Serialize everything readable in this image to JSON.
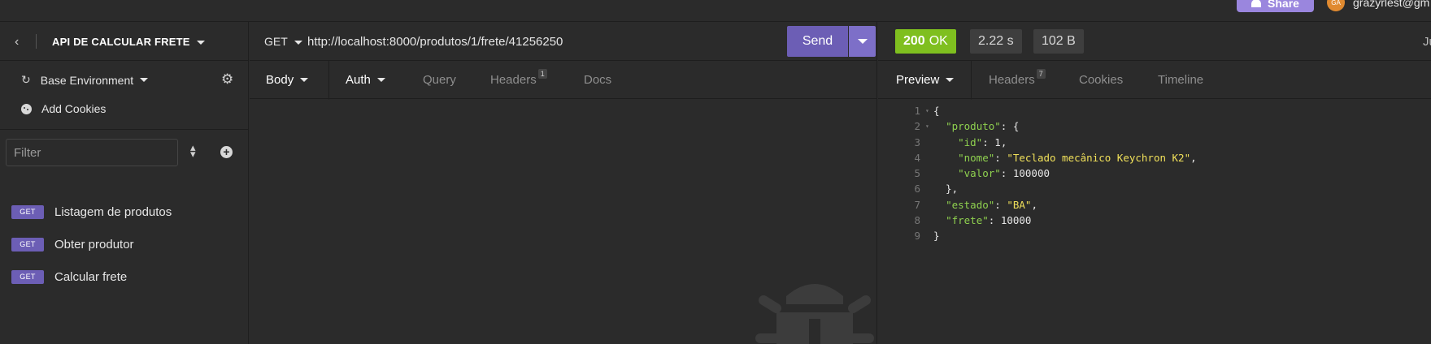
{
  "topbar": {
    "share_label": "Share",
    "avatar_initials": "GA",
    "user_email": "grazyrlest@gm"
  },
  "sidebar": {
    "project_title": "API DE CALCULAR FRETE",
    "environment_label": "Base Environment",
    "cookies_label": "Add Cookies",
    "filter_placeholder": "Filter",
    "requests": [
      {
        "method": "GET",
        "name": "Listagem de produtos"
      },
      {
        "method": "GET",
        "name": "Obter produtor"
      },
      {
        "method": "GET",
        "name": "Calcular frete"
      }
    ]
  },
  "request": {
    "method": "GET",
    "url": "http://localhost:8000/produtos/1/frete/41256250",
    "send_label": "Send",
    "tabs": {
      "body": "Body",
      "auth": "Auth",
      "query": "Query",
      "headers": "Headers",
      "headers_count": "1",
      "docs": "Docs"
    }
  },
  "response": {
    "status_code": "200",
    "status_text": "OK",
    "time": "2.22 s",
    "size": "102 B",
    "clipped_label": "Ju",
    "tabs": {
      "preview": "Preview",
      "headers": "Headers",
      "headers_count": "7",
      "cookies": "Cookies",
      "timeline": "Timeline"
    },
    "body_lines": [
      {
        "n": "1",
        "fold": true
      },
      {
        "n": "2",
        "fold": true
      },
      {
        "n": "3"
      },
      {
        "n": "4"
      },
      {
        "n": "5"
      },
      {
        "n": "6"
      },
      {
        "n": "7"
      },
      {
        "n": "8"
      },
      {
        "n": "9"
      }
    ],
    "json": {
      "produto_key": "\"produto\"",
      "id_key": "\"id\"",
      "id_val": "1",
      "nome_key": "\"nome\"",
      "nome_val": "\"Teclado mecânico Keychron K2\"",
      "valor_key": "\"valor\"",
      "valor_val": "100000",
      "estado_key": "\"estado\"",
      "estado_val": "\"BA\"",
      "frete_key": "\"frete\"",
      "frete_val": "10000"
    }
  },
  "colors": {
    "accent": "#6c5eb5",
    "status_ok": "#7fbf1f",
    "json_key": "#8fd14f",
    "json_string": "#f0e05a"
  }
}
